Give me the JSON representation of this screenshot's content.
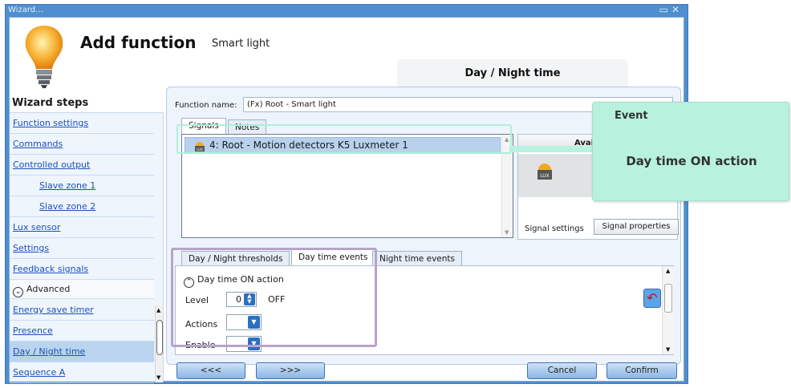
{
  "window": {
    "title": "Wizard...",
    "controls": [
      "restore",
      "close"
    ]
  },
  "header": {
    "title": "Add function",
    "subtitle": "Smart light",
    "step_tab": "Day / Night time"
  },
  "sidebar": {
    "title": "Wizard steps",
    "items_top": [
      {
        "label": "Function settings"
      },
      {
        "label": "Commands"
      },
      {
        "label": "Controlled output"
      },
      {
        "label": "Slave zone 1"
      },
      {
        "label": "Slave zone 2"
      },
      {
        "label": "Lux sensor"
      },
      {
        "label": "Settings"
      },
      {
        "label": "Feedback signals"
      }
    ],
    "advanced_label": "Advanced",
    "items_bottom": [
      {
        "label": "Energy save timer"
      },
      {
        "label": "Presence"
      },
      {
        "label": "Day / Night time"
      },
      {
        "label": "Sequence A"
      }
    ]
  },
  "function": {
    "name_label": "Function name:",
    "name_value": "(Fx) Root - Smart light"
  },
  "tabs_top": [
    "Signals",
    "Notes"
  ],
  "signals": {
    "row": "4: Root - Motion detectors K5 Luxmeter 1"
  },
  "available": {
    "header": "Availabl",
    "icon_text": "LUX",
    "signal_settings": "Signal settings",
    "signal_properties": "Signal properties"
  },
  "tabs_lower": [
    "Day / Night thresholds",
    "Day time events",
    "Night time events"
  ],
  "events": {
    "section": "Day time ON action",
    "level_label": "Level",
    "level_value": "0",
    "level_state": "OFF",
    "actions_label": "Actions",
    "enable_label": "Enable"
  },
  "buttons": {
    "prev": "<<<",
    "next": ">>>",
    "cancel": "Cancel",
    "confirm": "Confirm"
  },
  "callout": {
    "title": "Event",
    "body": "Day time ON action"
  },
  "colors": {
    "accent": "#4f8fcf",
    "callout": "#b8f2de",
    "highlight": "#b7a3cb",
    "button_blue": "#2a6fc2"
  }
}
